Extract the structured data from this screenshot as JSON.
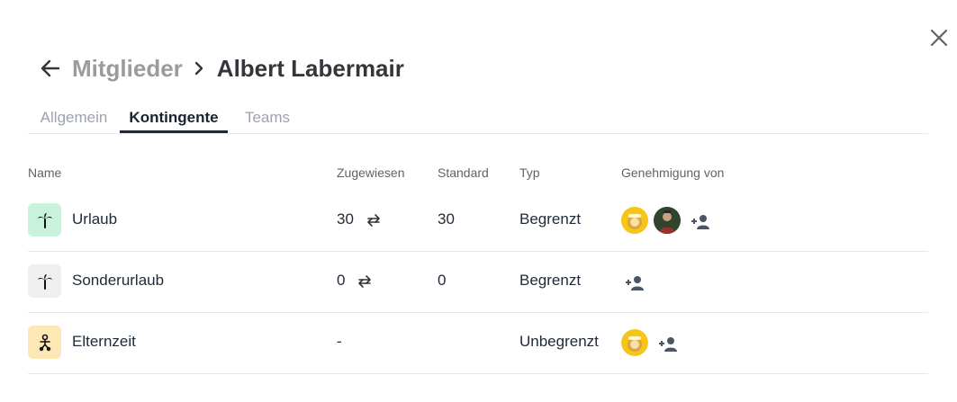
{
  "header": {
    "breadcrumb_parent": "Mitglieder",
    "title": "Albert Labermair"
  },
  "tabs": [
    {
      "label": "Allgemein",
      "active": false
    },
    {
      "label": "Kontingente",
      "active": true
    },
    {
      "label": "Teams",
      "active": false
    }
  ],
  "table": {
    "headers": {
      "name": "Name",
      "assigned": "Zugewiesen",
      "standard": "Standard",
      "type": "Typ",
      "approval": "Genehmigung von"
    },
    "rows": [
      {
        "name": "Urlaub",
        "icon": "palm-tree-icon",
        "icon_bg": "#c9f2dc",
        "assigned": "30",
        "standard": "30",
        "type": "Begrenzt",
        "approvers": [
          "avatar-yellow",
          "avatar-green"
        ]
      },
      {
        "name": "Sonderurlaub",
        "icon": "palm-tree-icon",
        "icon_bg": "#efefef",
        "assigned": "0",
        "standard": "0",
        "type": "Begrenzt",
        "approvers": []
      },
      {
        "name": "Elternzeit",
        "icon": "baby-icon",
        "icon_bg": "#fde7b5",
        "assigned": "-",
        "standard": "",
        "type": "Unbegrenzt",
        "approvers": [
          "avatar-yellow"
        ]
      }
    ]
  },
  "colors": {
    "accent": "#1b2a3a",
    "muted": "#9b9b9b",
    "divider": "#e5e7eb"
  }
}
